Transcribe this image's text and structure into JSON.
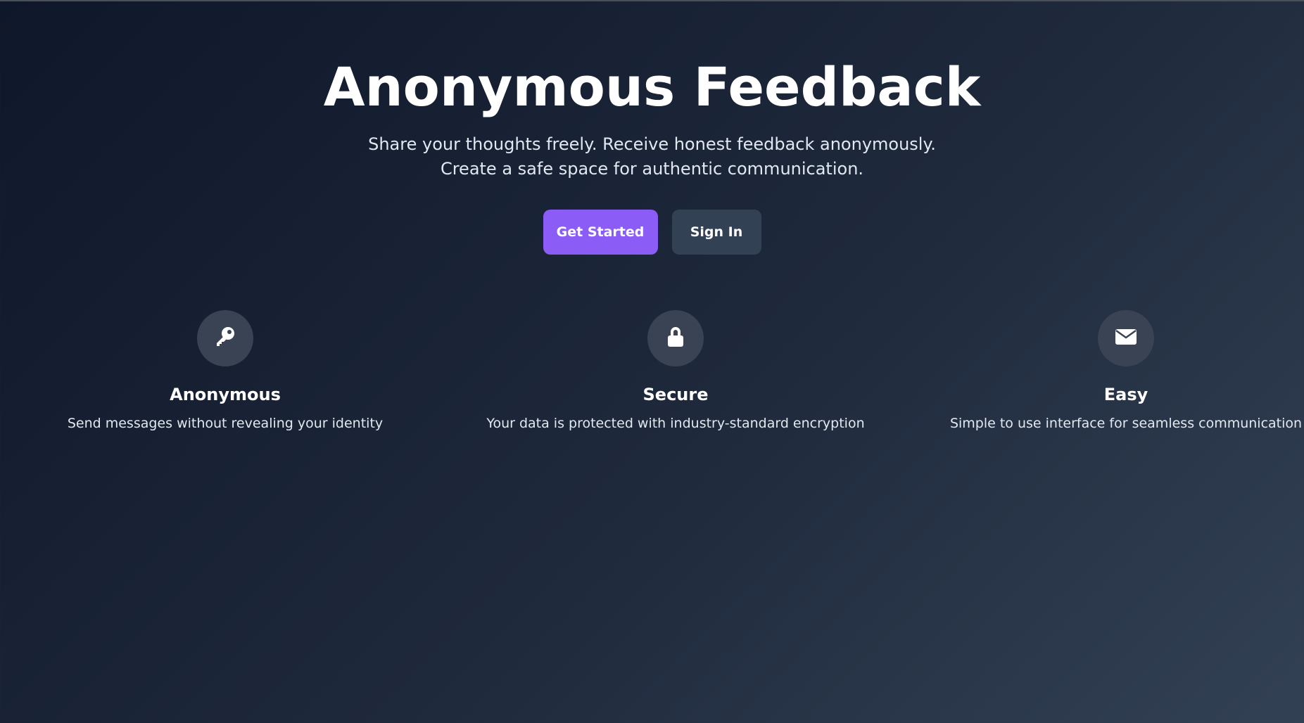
{
  "hero": {
    "title": "Anonymous Feedback",
    "subtitle": "Share your thoughts freely. Receive honest feedback anonymously. Create a safe space for authentic communication."
  },
  "buttons": {
    "get_started": "Get Started",
    "sign_in": "Sign In"
  },
  "features": [
    {
      "icon": "key-icon",
      "title": "Anonymous",
      "description": "Send messages without revealing your identity"
    },
    {
      "icon": "lock-icon",
      "title": "Secure",
      "description": "Your data is protected with industry-standard encryption"
    },
    {
      "icon": "envelope-icon",
      "title": "Easy",
      "description": "Simple to use interface for seamless communication"
    }
  ],
  "colors": {
    "primary": "#8b5cf6",
    "secondary": "#334155",
    "background_start": "#0f172a",
    "background_end": "#334155"
  }
}
